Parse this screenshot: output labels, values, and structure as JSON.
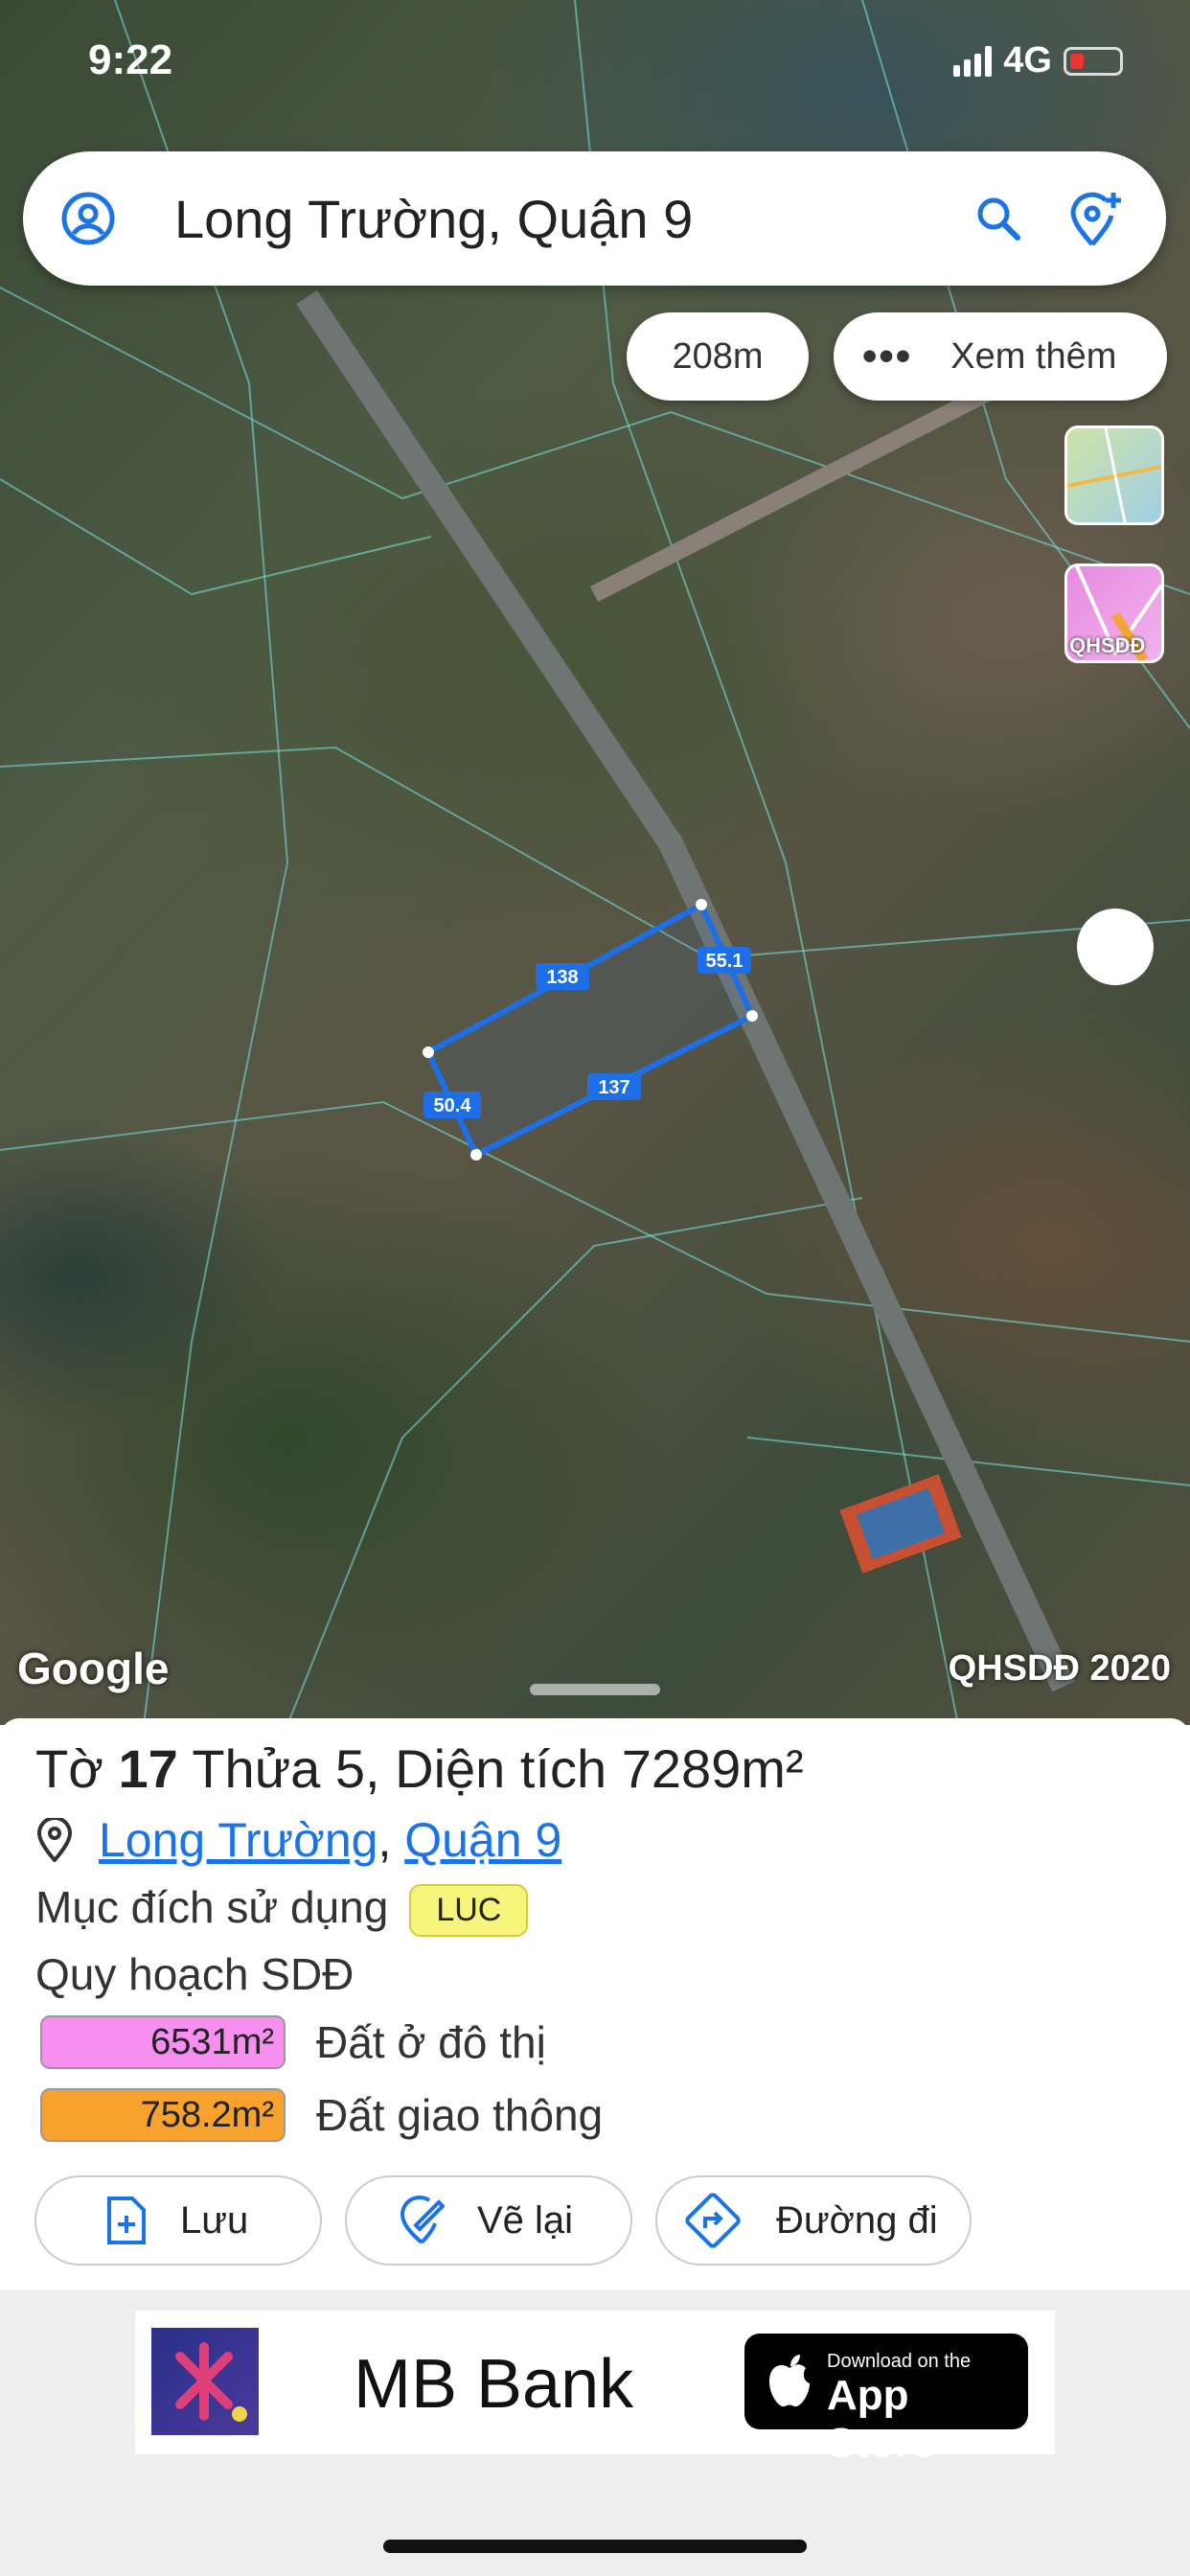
{
  "status": {
    "time": "9:22",
    "network": "4G"
  },
  "search": {
    "text": "Long Trường, Quận 9"
  },
  "map": {
    "scale": "208m",
    "more": "Xem thêm",
    "layer_label": "QHSDĐ",
    "google": "Google",
    "watermark": "QHSDĐ 2020",
    "edges": [
      "138",
      "55.1",
      "137",
      "50.4"
    ]
  },
  "parcel": {
    "title_prefix": "Tờ",
    "sheet": "17",
    "parcel_prefix": "Thửa",
    "parcel": "5,",
    "area_prefix": "Diện tích",
    "area": "7289",
    "area_unit": "m²",
    "ward": "Long Trường",
    "district": "Quận 9",
    "purpose_label": "Mục đích sử dụng",
    "purpose_code": "LUC",
    "plan_label": "Quy hoạch SDĐ",
    "plans": [
      {
        "area": "6531m²",
        "name": "Đất ở đô thị",
        "color": "#f78ff0"
      },
      {
        "area": "758.2m²",
        "name": "Đất giao thông",
        "color": "#f6a22d"
      }
    ]
  },
  "actions": {
    "save": "Lưu",
    "redraw": "Vẽ lại",
    "directions": "Đường đi"
  },
  "ad": {
    "name": "MB Bank",
    "store_small": "Download on the",
    "store_big": "App Store"
  },
  "colors": {
    "accent": "#1a73e8",
    "polygon": "#1e6ee8"
  }
}
